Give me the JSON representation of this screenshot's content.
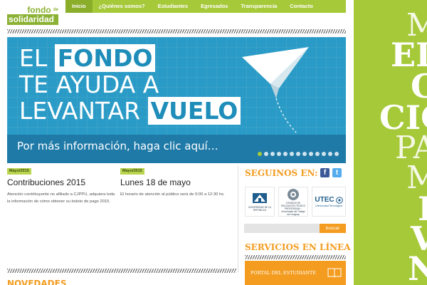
{
  "logo": {
    "top": "fondo",
    "small": "de",
    "bottom": "solidaridad"
  },
  "nav": {
    "items": [
      {
        "label": "Inicio",
        "active": true
      },
      {
        "label": "¿Quiénes somos?",
        "active": false
      },
      {
        "label": "Estudiantes",
        "active": false
      },
      {
        "label": "Egresados",
        "active": false
      },
      {
        "label": "Transparencia",
        "active": false
      },
      {
        "label": "Contacto",
        "active": false
      }
    ]
  },
  "hero": {
    "line1_plain": "EL ",
    "line1_box": "FONDO",
    "line2": "TE AYUDA A",
    "line3_plain": "LEVANTAR ",
    "line3_box": "VUELO",
    "cta": "Por más información, haga clic aquí…",
    "slide_count": 13,
    "active_slide": 1
  },
  "news": [
    {
      "badge": "Mayo/2015",
      "title": "Contribuciones 2015",
      "text": "Atención contribuyente no afiliado a CJPPU, adquiera toda la información de cómo obtener su boleto de pago 2015."
    },
    {
      "badge": "Mayo/2015",
      "title": "Lunes 18 de mayo",
      "text": "El horario de atención al público será de 9:00 a 12:30 hs."
    }
  ],
  "novedades": "NOVEDADES",
  "follow": {
    "title": "SEGUINOS EN:",
    "facebook": "f",
    "twitter": "t"
  },
  "partners": [
    {
      "name": "UNIVERSIDAD DE LA REPÚBLICA",
      "icon": "udelar-logo-icon"
    },
    {
      "name": "CONSEJO DE EDUCACIÓN TÉCNICO PROFESIONAL · Universidad del Trabajo del Uruguay",
      "icon": "utu-logo-icon"
    },
    {
      "name": "UTEC",
      "sub": "Universidad Tecnológica",
      "icon": "utec-logo-icon"
    }
  ],
  "search": {
    "placeholder": "",
    "button": "buscar"
  },
  "services": {
    "title": "SERVICIOS EN LÍNEA",
    "portal": "PORTAL DEL ESTUDIANTE",
    "icon": "book-icon"
  },
  "side_banner": {
    "words": [
      "M",
      "EL",
      "C",
      "CIC",
      "PA",
      "M",
      "L",
      "V",
      "N"
    ]
  },
  "colors": {
    "green": "#a6c93a",
    "orange": "#f39c1f",
    "blue": "#2a9bc6"
  }
}
